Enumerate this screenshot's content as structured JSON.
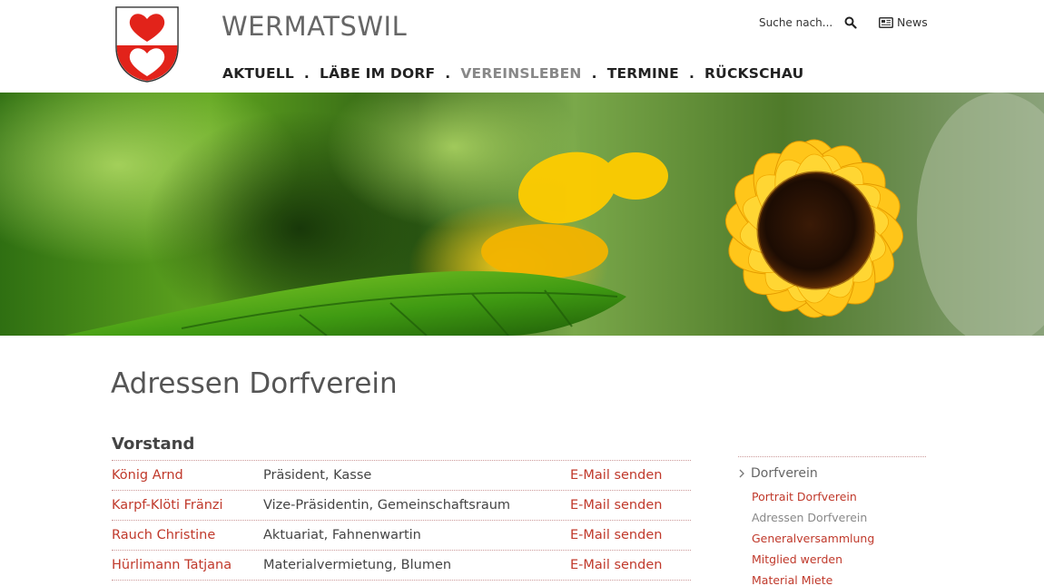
{
  "site": {
    "title": "WERMATSWIL"
  },
  "nav": {
    "items": [
      {
        "label": "AKTUELL",
        "active": false
      },
      {
        "label": "LÄBE IM DORF",
        "active": false
      },
      {
        "label": "VEREINSLEBEN",
        "active": true
      },
      {
        "label": "TERMINE",
        "active": false
      },
      {
        "label": "RÜCKSCHAU",
        "active": false
      }
    ],
    "separator": "."
  },
  "search": {
    "placeholder": "Suche nach..."
  },
  "news": {
    "label": "News"
  },
  "main": {
    "title": "Adressen Dorfverein",
    "section": "Vorstand",
    "members": [
      {
        "name": "König Arnd",
        "role": "Präsident, Kasse",
        "mail": "E-Mail senden"
      },
      {
        "name": "Karpf-Klöti Fränzi",
        "role": "Vize-Präsidentin, Gemeinschaftsraum",
        "mail": "E-Mail senden"
      },
      {
        "name": "Rauch Christine",
        "role": "Aktuariat, Fahnenwartin",
        "mail": "E-Mail senden"
      },
      {
        "name": "Hürlimann Tatjana",
        "role": "Materialvermietung, Blumen",
        "mail": "E-Mail senden"
      }
    ]
  },
  "sidebar": {
    "heading": "Dorfverein",
    "items": [
      {
        "label": "Portrait Dorfverein",
        "current": false
      },
      {
        "label": "Adressen Dorfverein",
        "current": true
      },
      {
        "label": "Generalversammlung",
        "current": false
      },
      {
        "label": "Mitglied werden",
        "current": false
      },
      {
        "label": "Material Miete",
        "current": false
      }
    ]
  },
  "colors": {
    "accent": "#c0392b",
    "crest_red": "#e2231a",
    "nav_active": "#888888"
  },
  "icons": {
    "search": "search-icon",
    "news": "newspaper-icon",
    "chevron": "chevron-right-icon"
  }
}
